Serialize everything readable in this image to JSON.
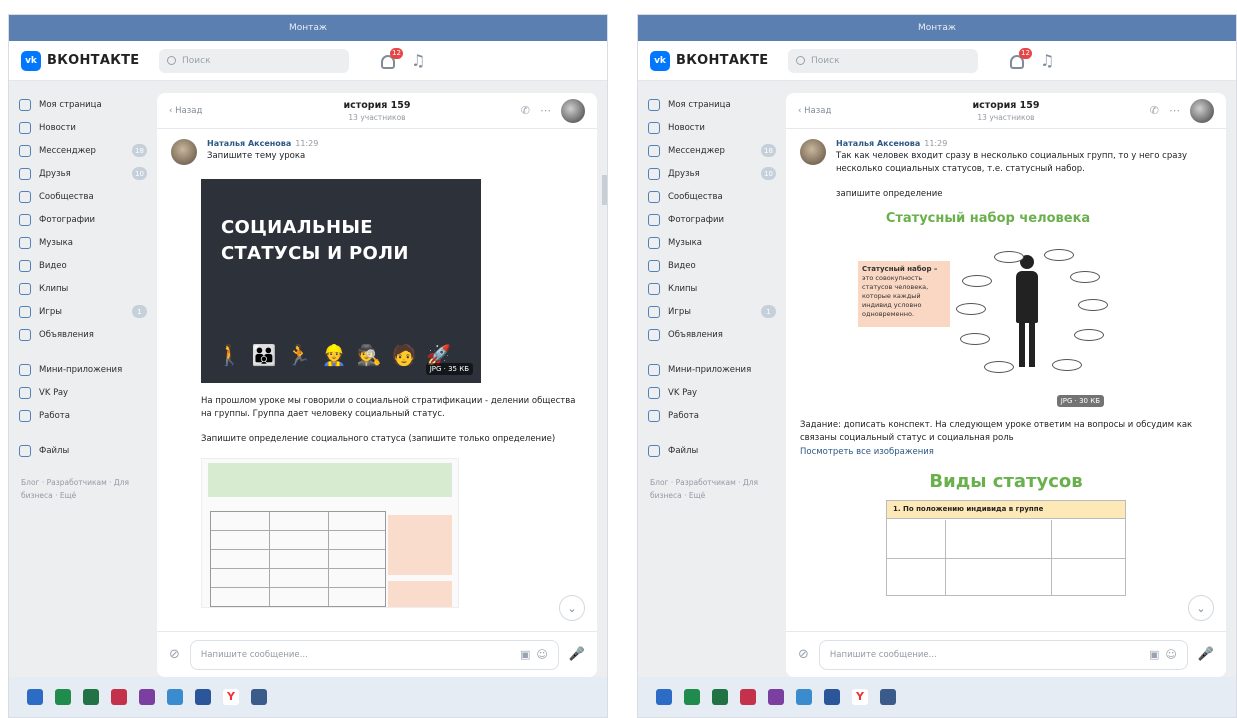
{
  "left": {
    "window_title": "Монтаж",
    "logo": "ВКОНТАКТЕ",
    "search_placeholder": "Поиск",
    "notif_badge": "12",
    "nav": [
      {
        "label": "Моя страница",
        "count": ""
      },
      {
        "label": "Новости",
        "count": ""
      },
      {
        "label": "Мессенджер",
        "count": "18"
      },
      {
        "label": "Друзья",
        "count": "10"
      },
      {
        "label": "Сообщества",
        "count": ""
      },
      {
        "label": "Фотографии",
        "count": ""
      },
      {
        "label": "Музыка",
        "count": ""
      },
      {
        "label": "Видео",
        "count": ""
      },
      {
        "label": "Клипы",
        "count": ""
      },
      {
        "label": "Игры",
        "count": "1"
      },
      {
        "label": "Объявления",
        "count": ""
      }
    ],
    "nav2": [
      {
        "label": "Мини-приложения"
      },
      {
        "label": "VK Pay"
      },
      {
        "label": "Работа"
      }
    ],
    "nav3": [
      {
        "label": "Файлы"
      }
    ],
    "footer": "Блог · Разработчикам · Для бизнеса · Ещё",
    "chat": {
      "back": "Назад",
      "name": "история 159",
      "subtitle": "13 участников"
    },
    "message": {
      "author": "Наталья Аксенова",
      "time": "11:29",
      "text": "Запишите тему урока"
    },
    "slide": {
      "line1": "СОЦИАЛЬНЫЕ",
      "line2": "СТАТУСЫ И РОЛИ",
      "icons": "🚶👪🏃👷🕵🧑🚀",
      "tag": "JPG · 35 КБ"
    },
    "para1": "На прошлом уроке мы говорили о социальной стратификации - делении общества на группы. Группа дает человеку социальный статус.",
    "para2": "Запишите определение социального статуса (запишите только определение)",
    "composer_placeholder": "Напишите сообщение..."
  },
  "right": {
    "window_title": "Монтаж",
    "logo": "ВКОНТАКТЕ",
    "search_placeholder": "Поиск",
    "notif_badge": "12",
    "nav": [
      {
        "label": "Моя страница",
        "count": ""
      },
      {
        "label": "Новости",
        "count": ""
      },
      {
        "label": "Мессенджер",
        "count": "18"
      },
      {
        "label": "Друзья",
        "count": "10"
      },
      {
        "label": "Сообщества",
        "count": ""
      },
      {
        "label": "Фотографии",
        "count": ""
      },
      {
        "label": "Музыка",
        "count": ""
      },
      {
        "label": "Видео",
        "count": ""
      },
      {
        "label": "Клипы",
        "count": ""
      },
      {
        "label": "Игры",
        "count": "1"
      },
      {
        "label": "Объявления",
        "count": ""
      }
    ],
    "nav2": [
      {
        "label": "Мини-приложения"
      },
      {
        "label": "VK Pay"
      },
      {
        "label": "Работа"
      }
    ],
    "nav3": [
      {
        "label": "Файлы"
      }
    ],
    "footer": "Блог · Разработчикам · Для бизнеса · Ещё",
    "chat": {
      "back": "Назад",
      "name": "история 159",
      "subtitle": "13 участников"
    },
    "message": {
      "author": "Наталья Аксенова",
      "time": "11:29",
      "text": "Так как человек входит сразу в несколько социальных групп, то у него сразу несколько социальных статусов, т.е. статусный набор."
    },
    "para_def": "запишите определение",
    "info": {
      "title": "Статусный набор человека",
      "pink_head": "Статусный набор –",
      "pink_text": "это совокупность статусов человека, которые каждый индивид условно одновременно.",
      "tag": "JPG · 30 КБ"
    },
    "task": "Задание: дописать конспект. На следующем уроке ответим на вопросы и обсудим как связаны социальный статус и социальная роль",
    "link": "Посмотреть все изображения",
    "big_title": "Виды статусов",
    "table_head": "1. По положению индивида в группе",
    "composer_placeholder": "Напишите сообщение..."
  }
}
